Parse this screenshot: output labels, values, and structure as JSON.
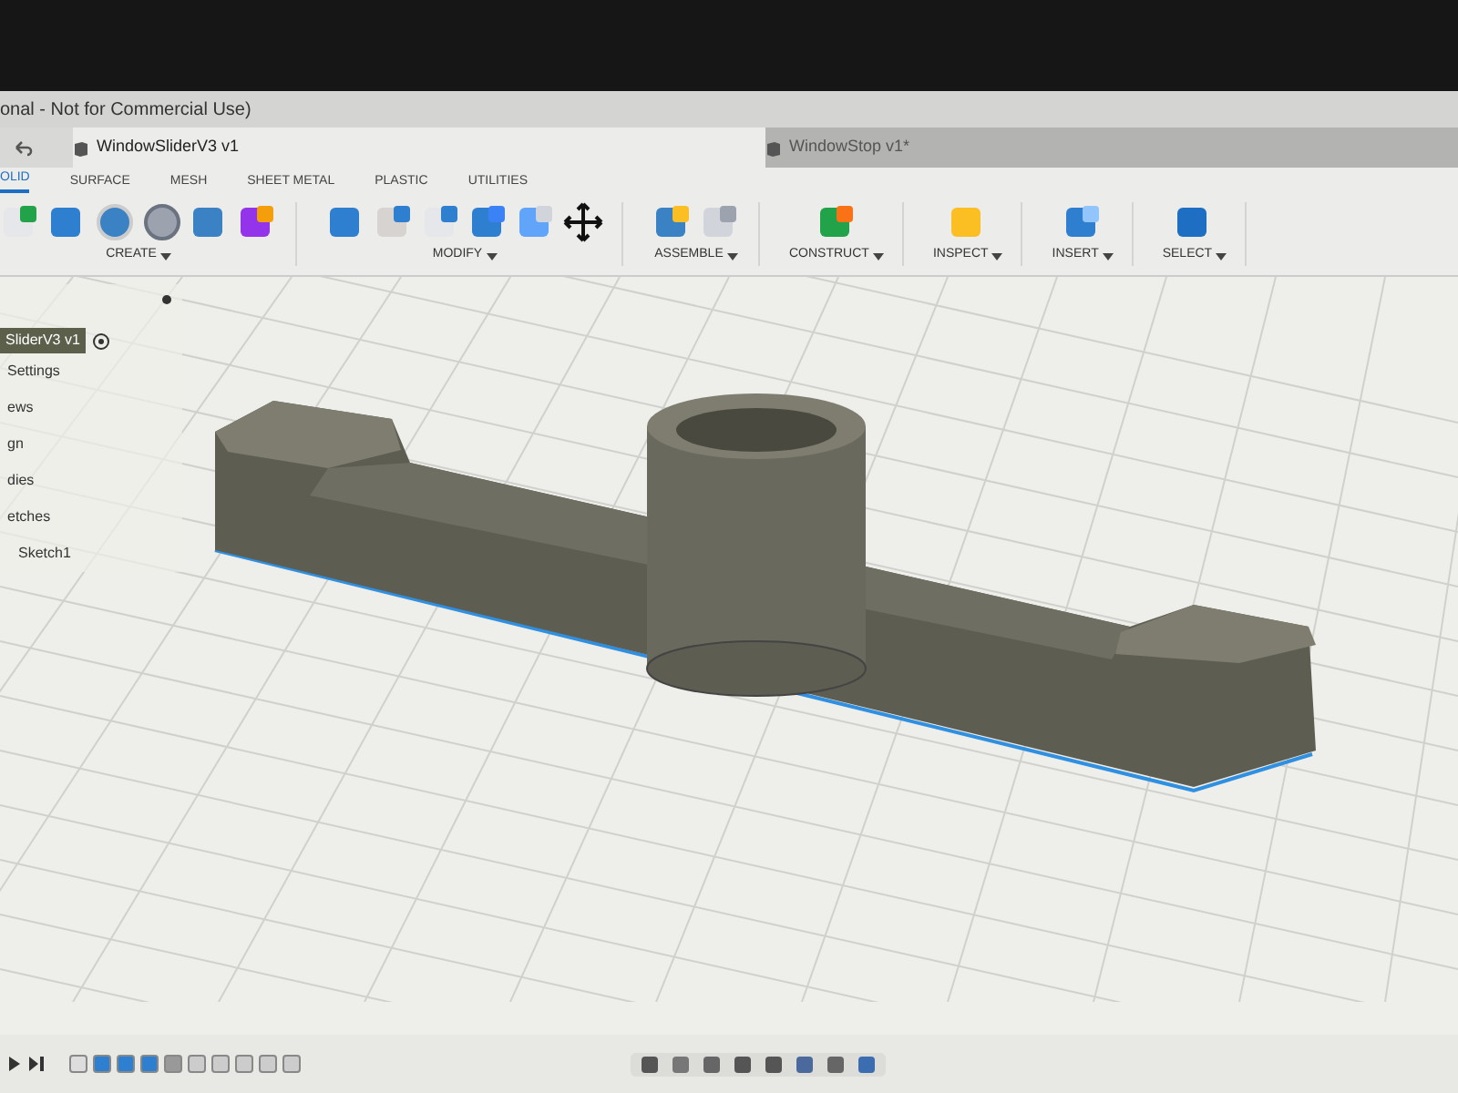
{
  "window": {
    "title": "onal - Not for Commercial Use)"
  },
  "document_tabs": [
    {
      "label": "WindowSliderV3 v1",
      "selected": true
    },
    {
      "label": "WindowStop v1*",
      "selected": false
    }
  ],
  "toolbar": {
    "tabs": [
      {
        "label": "OLID",
        "selected": true
      },
      {
        "label": "SURFACE",
        "selected": false
      },
      {
        "label": "MESH",
        "selected": false
      },
      {
        "label": "SHEET METAL",
        "selected": false
      },
      {
        "label": "PLASTIC",
        "selected": false
      },
      {
        "label": "UTILITIES",
        "selected": false
      }
    ],
    "groups": [
      {
        "label": "CREATE"
      },
      {
        "label": "MODIFY"
      },
      {
        "label": "ASSEMBLE"
      },
      {
        "label": "CONSTRUCT"
      },
      {
        "label": "INSPECT"
      },
      {
        "label": "INSERT"
      },
      {
        "label": "SELECT"
      }
    ]
  },
  "browser": {
    "root": "SliderV3 v1",
    "items": [
      {
        "label": "Settings"
      },
      {
        "label": "ews"
      },
      {
        "label": "gn"
      },
      {
        "label": "dies"
      },
      {
        "label": "etches",
        "children": [
          {
            "label": "Sketch1"
          }
        ]
      }
    ]
  }
}
